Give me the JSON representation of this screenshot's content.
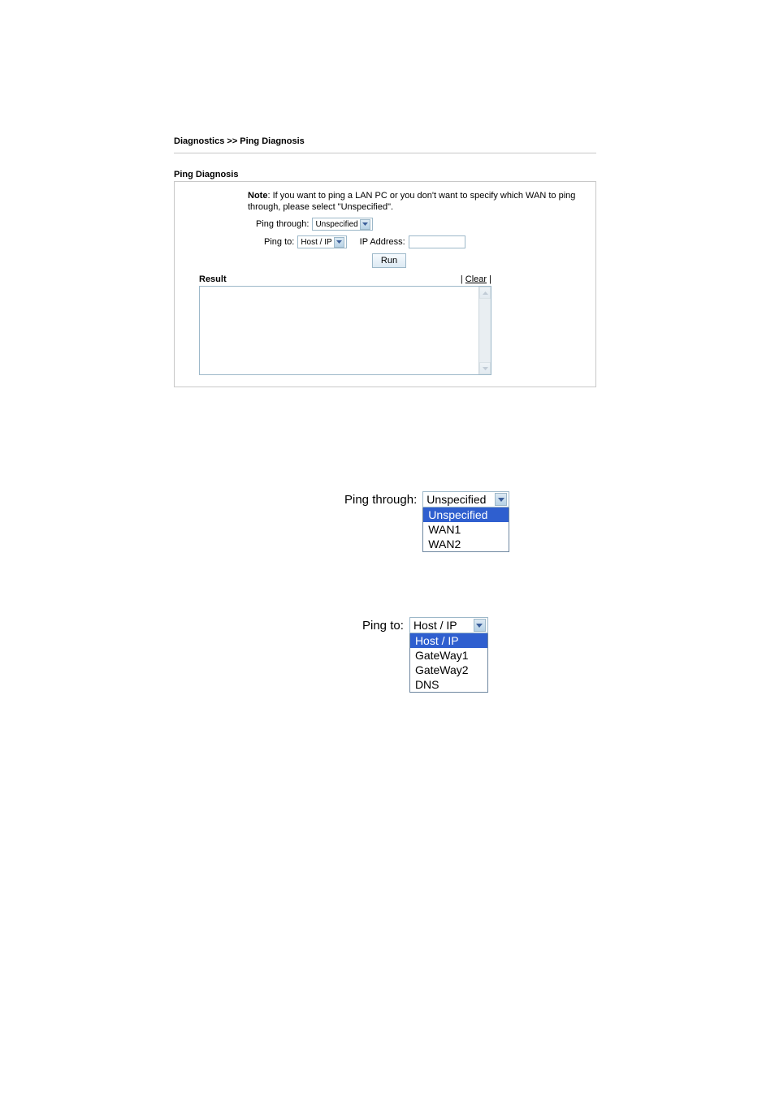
{
  "breadcrumb": "Diagnostics >> Ping Diagnosis",
  "section_title": "Ping Diagnosis",
  "note": {
    "label": "Note",
    "text": ": If you want to ping a LAN PC or you don't want to specify which WAN to ping through, please select \"Unspecified\"."
  },
  "form": {
    "ping_through_label": "Ping through:",
    "ping_through_value": "Unspecified",
    "ping_to_label": "Ping to:",
    "ping_to_value": "Host / IP",
    "ip_address_label": "IP Address:",
    "ip_address_value": "",
    "run_button": "Run"
  },
  "result": {
    "label": "Result",
    "clear_left": "|  ",
    "clear_link": "Clear",
    "clear_right": "  |",
    "value": ""
  },
  "dd1": {
    "label": "Ping through:",
    "selected": "Unspecified",
    "options": [
      "Unspecified",
      "WAN1",
      "WAN2"
    ]
  },
  "dd2": {
    "label": "Ping to:",
    "selected": "Host / IP",
    "options": [
      "Host / IP",
      "GateWay1",
      "GateWay2",
      "DNS"
    ]
  }
}
